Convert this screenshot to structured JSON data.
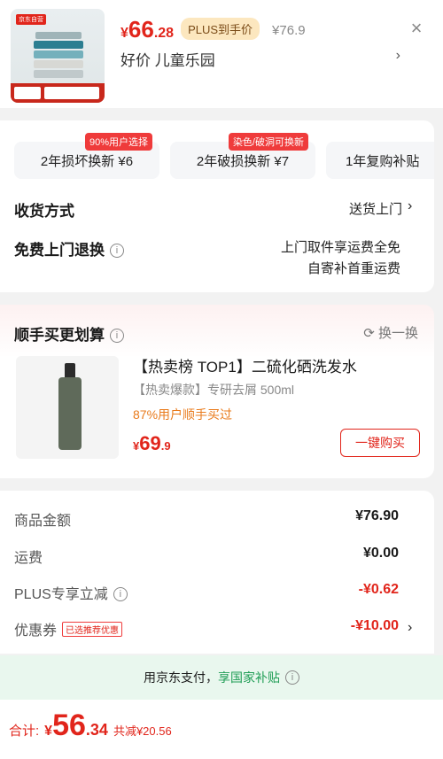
{
  "header": {
    "image_tag": "京东自营",
    "price_symbol": "¥",
    "price_int": "66",
    "price_dec": ".28",
    "plus_badge": "PLUS到手价",
    "original_price": "¥76.9",
    "shop_name": "好价  儿童乐园",
    "close_icon": "×",
    "chevron": "›"
  },
  "services": [
    {
      "label": "2年损坏换新  ¥6",
      "badge": "90%用户选择"
    },
    {
      "label": "2年破损换新  ¥7",
      "badge": "染色/破洞可换新"
    },
    {
      "label": "1年复购补贴",
      "badge": ""
    }
  ],
  "delivery": {
    "label": "收货方式",
    "value": "送货上门"
  },
  "returns": {
    "label": "免费上门退换",
    "line1": "上门取件享运费全免",
    "line2": "自寄补首重运费"
  },
  "addon": {
    "title": "顺手买更划算",
    "swap_label": "换一换",
    "product_name": "【热卖榜 TOP1】二硫化硒洗发水",
    "product_desc": "【热卖爆款】专研去屑 500ml",
    "product_stat": "87%用户顺手买过",
    "price_symbol": "¥",
    "price_int": "69",
    "price_dec": ".9",
    "buy_label": "一键购买"
  },
  "summary": {
    "rows": [
      {
        "label": "商品金额",
        "value": "¥76.90",
        "red": false
      },
      {
        "label": "运费",
        "value": "¥0.00",
        "red": false
      },
      {
        "label": "PLUS专享立减",
        "value": "-¥0.62",
        "red": true
      },
      {
        "label": "优惠券",
        "value": "-¥10.00",
        "red": true,
        "tag": "已选推荐优惠"
      }
    ]
  },
  "subsidy": {
    "prefix": "用京东支付，",
    "highlight": "享国家补贴"
  },
  "total": {
    "label": "合计:",
    "symbol": "¥",
    "int": "56",
    "dec": ".34",
    "discount": "共减¥20.56"
  },
  "colors": {
    "accent": "#e1251b",
    "plus": "#fce7bf",
    "subsidy_bg": "#e9f7ee",
    "subsidy_text": "#1f9d55"
  }
}
